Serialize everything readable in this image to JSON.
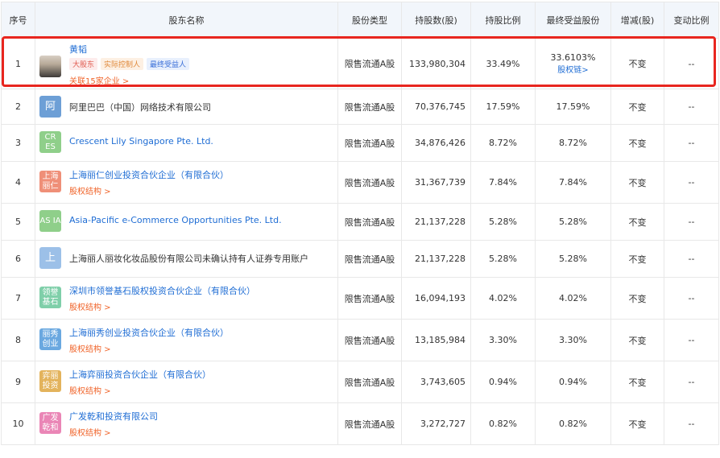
{
  "headers": [
    "序号",
    "股东名称",
    "股份类型",
    "持股数(股)",
    "持股比例",
    "最终受益股份",
    "增减(股)",
    "变动比例"
  ],
  "rows": [
    {
      "no": "1",
      "name": "黄韬",
      "logo_text": "",
      "tags": [
        "大股东",
        "实际控制人",
        "最终受益人"
      ],
      "sub": "关联15家企业 >",
      "type": "限售流通A股",
      "shares": "133,980,304",
      "ratio": "33.49%",
      "final": "33.6103%",
      "final_link": "股权链>",
      "change": "不变",
      "change_ratio": "--"
    },
    {
      "no": "2",
      "name": "阿里巴巴（中国）网络技术有限公司",
      "logo_text": "阿",
      "logo_color": "#6d9fd6",
      "sub": "",
      "type": "限售流通A股",
      "shares": "70,376,745",
      "ratio": "17.59%",
      "final": "17.59%",
      "change": "不变",
      "change_ratio": "--"
    },
    {
      "no": "3",
      "name": "Crescent Lily Singapore Pte. Ltd.",
      "logo_text": "CR ES",
      "logo_color": "#8fcf8a",
      "sub": "",
      "type": "限售流通A股",
      "shares": "34,876,426",
      "ratio": "8.72%",
      "final": "8.72%",
      "change": "不变",
      "change_ratio": "--"
    },
    {
      "no": "4",
      "name": "上海丽仁创业投资合伙企业（有限合伙）",
      "logo_text": "上海 丽仁",
      "logo_color": "#ef8f78",
      "sub": "股权结构 >",
      "type": "限售流通A股",
      "shares": "31,367,739",
      "ratio": "7.84%",
      "final": "7.84%",
      "change": "不变",
      "change_ratio": "--"
    },
    {
      "no": "5",
      "name": "Asia-Pacific e-Commerce Opportunities Pte. Ltd.",
      "logo_text": "AS IA",
      "logo_color": "#8fcf8a",
      "sub": "",
      "type": "限售流通A股",
      "shares": "21,137,228",
      "ratio": "5.28%",
      "final": "5.28%",
      "change": "不变",
      "change_ratio": "--"
    },
    {
      "no": "6",
      "name": "上海丽人丽妆化妆品股份有限公司未确认持有人证券专用账户",
      "logo_text": "上",
      "logo_color": "#9cc0e8",
      "sub": "",
      "type": "限售流通A股",
      "shares": "21,137,228",
      "ratio": "5.28%",
      "final": "5.28%",
      "change": "不变",
      "change_ratio": "--"
    },
    {
      "no": "7",
      "name": "深圳市领誉基石股权投资合伙企业（有限合伙）",
      "logo_text": "领誉 基石",
      "logo_color": "#7fcfa9",
      "sub": "股权结构 >",
      "type": "限售流通A股",
      "shares": "16,094,193",
      "ratio": "4.02%",
      "final": "4.02%",
      "change": "不变",
      "change_ratio": "--"
    },
    {
      "no": "8",
      "name": "上海丽秀创业投资合伙企业（有限合伙）",
      "logo_text": "丽秀 创业",
      "logo_color": "#6aa8e0",
      "sub": "股权结构 >",
      "type": "限售流通A股",
      "shares": "13,185,984",
      "ratio": "3.30%",
      "final": "3.30%",
      "change": "不变",
      "change_ratio": "--"
    },
    {
      "no": "9",
      "name": "上海弈丽投资合伙企业（有限合伙）",
      "logo_text": "弈丽 投资",
      "logo_color": "#e3b35c",
      "sub": "股权结构 >",
      "type": "限售流通A股",
      "shares": "3,743,605",
      "ratio": "0.94%",
      "final": "0.94%",
      "change": "不变",
      "change_ratio": "--"
    },
    {
      "no": "10",
      "name": "广发乾和投资有限公司",
      "logo_text": "广发 乾和",
      "logo_color": "#ea86b6",
      "sub": "股权结构 >",
      "type": "限售流通A股",
      "shares": "3,272,727",
      "ratio": "0.82%",
      "final": "0.82%",
      "change": "不变",
      "change_ratio": "--"
    }
  ]
}
